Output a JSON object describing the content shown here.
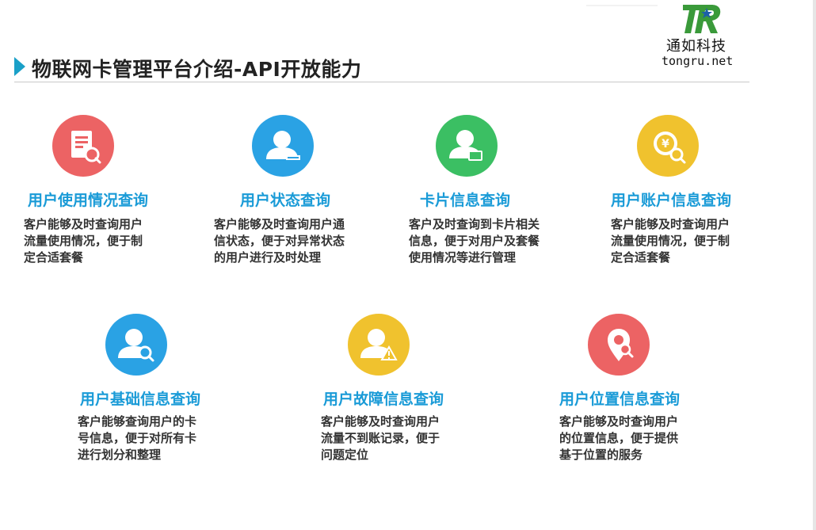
{
  "title": "物联网卡管理平台介绍-API开放能力",
  "logo": {
    "mark": "TR",
    "cn": "通如科技",
    "en": "tongru.net"
  },
  "features": [
    {
      "title": "用户使用情况查询",
      "desc": [
        "客户能够及时查询用户",
        "流量使用情况，便于制",
        "定合适套餐"
      ],
      "icon": "document-search-icon",
      "color": "#ec6364"
    },
    {
      "title": "用户状态查询",
      "desc": [
        "客户能够及时查询用户通",
        "信状态，便于对异常状态",
        "的用户进行及时处理"
      ],
      "icon": "user-status-icon",
      "color": "#2aa2e4"
    },
    {
      "title": "卡片信息查询",
      "desc": [
        "客户及时查询到卡片相关",
        "信息，便于对用户及套餐",
        "使用情况等进行管理"
      ],
      "icon": "user-card-icon",
      "color": "#3bbf63"
    },
    {
      "title": "用户账户信息查询",
      "desc": [
        "客户能够及时查询用户",
        "流量使用情况，便于制",
        "定合适套餐"
      ],
      "icon": "yen-search-icon",
      "color": "#f0c22e"
    },
    {
      "title": "用户基础信息查询",
      "desc": [
        "客户能够查询用户的卡",
        "号信息，便于对所有卡",
        "进行划分和整理"
      ],
      "icon": "user-search-icon",
      "color": "#2aa2e4"
    },
    {
      "title": "用户故障信息查询",
      "desc": [
        "客户能够及时查询用户",
        "流量不到账记录，便于",
        "问题定位"
      ],
      "icon": "user-warning-icon",
      "color": "#f0c22e"
    },
    {
      "title": "用户位置信息查询",
      "desc": [
        "客户能够及时查询用户",
        "的位置信息，便于提供",
        "基于位置的服务"
      ],
      "icon": "location-search-icon",
      "color": "#ec6364"
    }
  ]
}
